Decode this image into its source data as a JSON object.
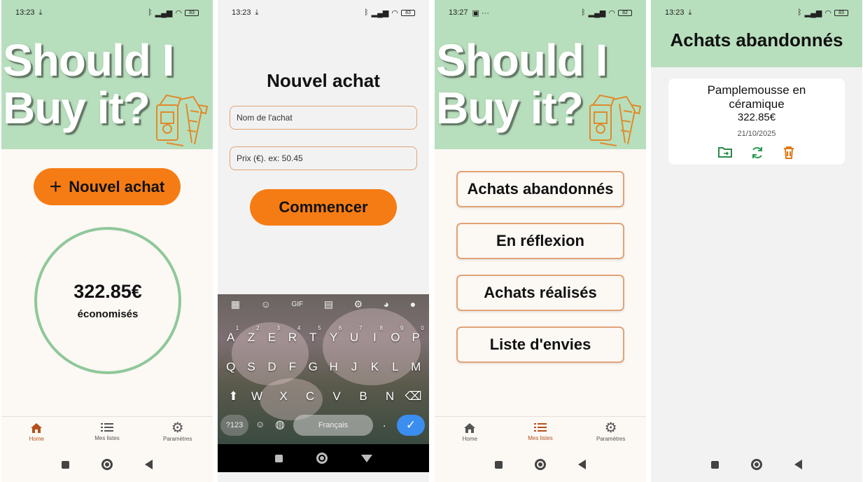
{
  "status": {
    "time_a": "13:23",
    "time_b": "13:27",
    "battery_a": "83",
    "battery_b": "82"
  },
  "home": {
    "hero_title_line1": "Should I",
    "hero_title_line2": "Buy it?",
    "new_purchase_label": "Nouvel achat",
    "savings_amount": "322.85€",
    "savings_label": "économisés"
  },
  "nav": {
    "home": "Home",
    "lists": "Mes listes",
    "settings": "Paramètres"
  },
  "new_purchase": {
    "title": "Nouvel achat",
    "name_placeholder": "Nom de l'achat",
    "price_placeholder": "Prix (€). ex: 50.45",
    "start_label": "Commencer"
  },
  "keyboard": {
    "row1": [
      "A",
      "Z",
      "E",
      "R",
      "T",
      "Y",
      "U",
      "I",
      "O",
      "P"
    ],
    "row1_hints": [
      "1",
      "2",
      "3",
      "4",
      "5",
      "6",
      "7",
      "8",
      "9",
      "0"
    ],
    "row2": [
      "Q",
      "S",
      "D",
      "F",
      "G",
      "H",
      "J",
      "K",
      "L",
      "M"
    ],
    "row3": [
      "W",
      "X",
      "C",
      "V",
      "B",
      "N"
    ],
    "num_key": "?123",
    "space_label": "Français",
    "period": "."
  },
  "lists": {
    "items": [
      "Achats abandonnés",
      "En réflexion",
      "Achats réalisés",
      "Liste d'envies"
    ]
  },
  "abandoned": {
    "title": "Achats abandonnés",
    "item_name": "Pamplemousse en céramique",
    "item_price": "322.85€",
    "item_date": "21/10/2025"
  },
  "colors": {
    "mint": "#b8dfbd",
    "orange": "#f57c14",
    "cream": "#fcf8f4",
    "accent_brown": "#b4501c",
    "border_peach": "#e0a377"
  }
}
